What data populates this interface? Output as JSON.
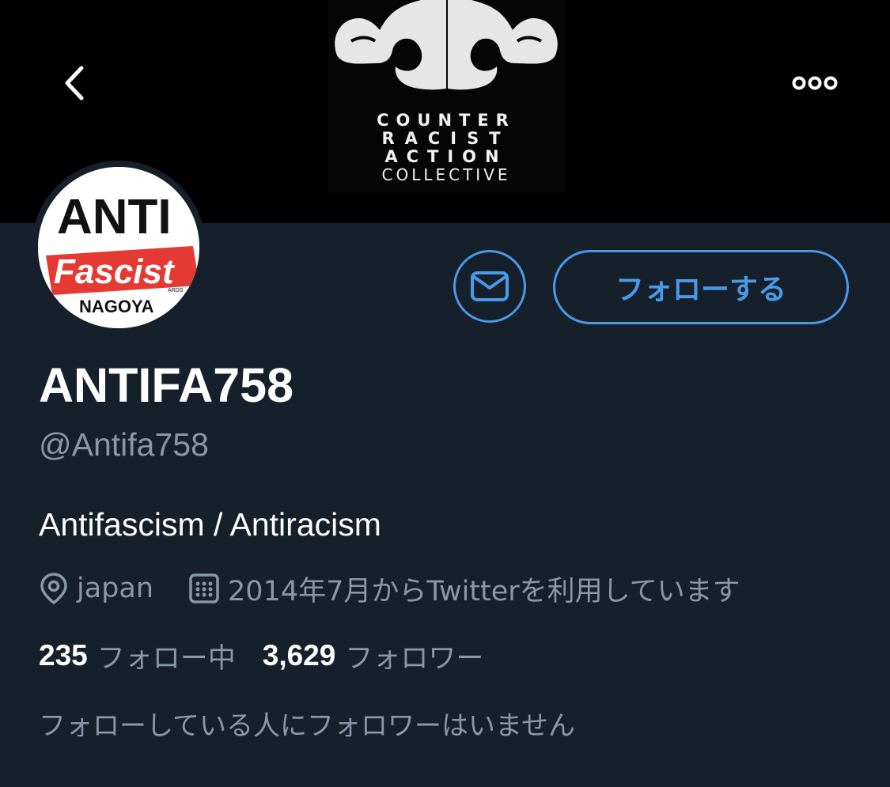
{
  "banner": {
    "lines": [
      "COUNTER",
      "RACIST",
      "ACTION",
      "COLLECTIVE"
    ]
  },
  "avatar": {
    "line1": "ANTI",
    "line2": "Fascist",
    "line3": "NAGOYA",
    "small": "ARDS"
  },
  "nav": {
    "back_icon": "chevron-left-icon",
    "more_icon": "more-horizontal-icon"
  },
  "actions": {
    "message_icon": "envelope-icon",
    "follow_label": "フォローする"
  },
  "profile": {
    "display_name": "ANTIFA758",
    "handle": "@Antifa758",
    "bio": "Antifascism / Antiracism",
    "location": "japan",
    "joined": "2014年7月からTwitterを利用しています"
  },
  "counts": {
    "following_count": "235",
    "following_label": "フォロー中",
    "followers_count": "3,629",
    "followers_label": "フォロワー"
  },
  "followed_by_note": "フォローしている人にフォロワーはいません",
  "colors": {
    "background": "#15202b",
    "accent": "#4a99e9",
    "secondary_text": "#8899a6",
    "primary_text": "#ffffff",
    "avatar_red": "#e53a33"
  }
}
